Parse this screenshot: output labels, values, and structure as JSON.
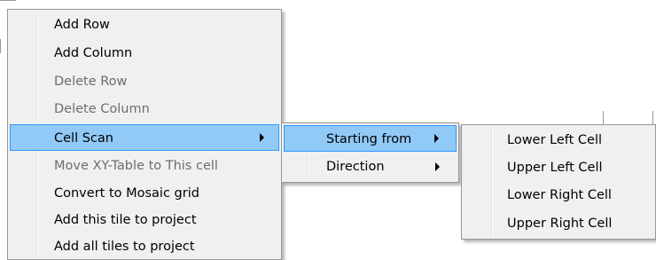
{
  "main_menu": {
    "items": [
      {
        "label": "Add Row",
        "enabled": true
      },
      {
        "label": "Add Column",
        "enabled": true
      },
      {
        "label": "Delete Row",
        "enabled": false
      },
      {
        "label": "Delete Column",
        "enabled": false
      },
      {
        "label": "Cell Scan",
        "enabled": true,
        "has_submenu": true,
        "highlighted": true
      },
      {
        "label": "Move XY-Table to This cell",
        "enabled": false
      },
      {
        "label": "Convert to Mosaic grid",
        "enabled": true
      },
      {
        "label": "Add this tile to project",
        "enabled": true
      },
      {
        "label": "Add all tiles to project",
        "enabled": true
      }
    ]
  },
  "cell_scan_submenu": {
    "items": [
      {
        "label": "Starting from",
        "has_submenu": true,
        "highlighted": true
      },
      {
        "label": "Direction",
        "has_submenu": true
      }
    ]
  },
  "starting_from_submenu": {
    "items": [
      {
        "label": "Lower Left Cell"
      },
      {
        "label": "Upper Left Cell"
      },
      {
        "label": "Lower Right Cell"
      },
      {
        "label": "Upper Right Cell"
      }
    ]
  },
  "colors": {
    "menu_background": "#f0f0f0",
    "menu_border": "#979797",
    "highlight_fill": "#91c9f7",
    "highlight_border": "#3399ff",
    "disabled_text": "#6d6d6d"
  }
}
